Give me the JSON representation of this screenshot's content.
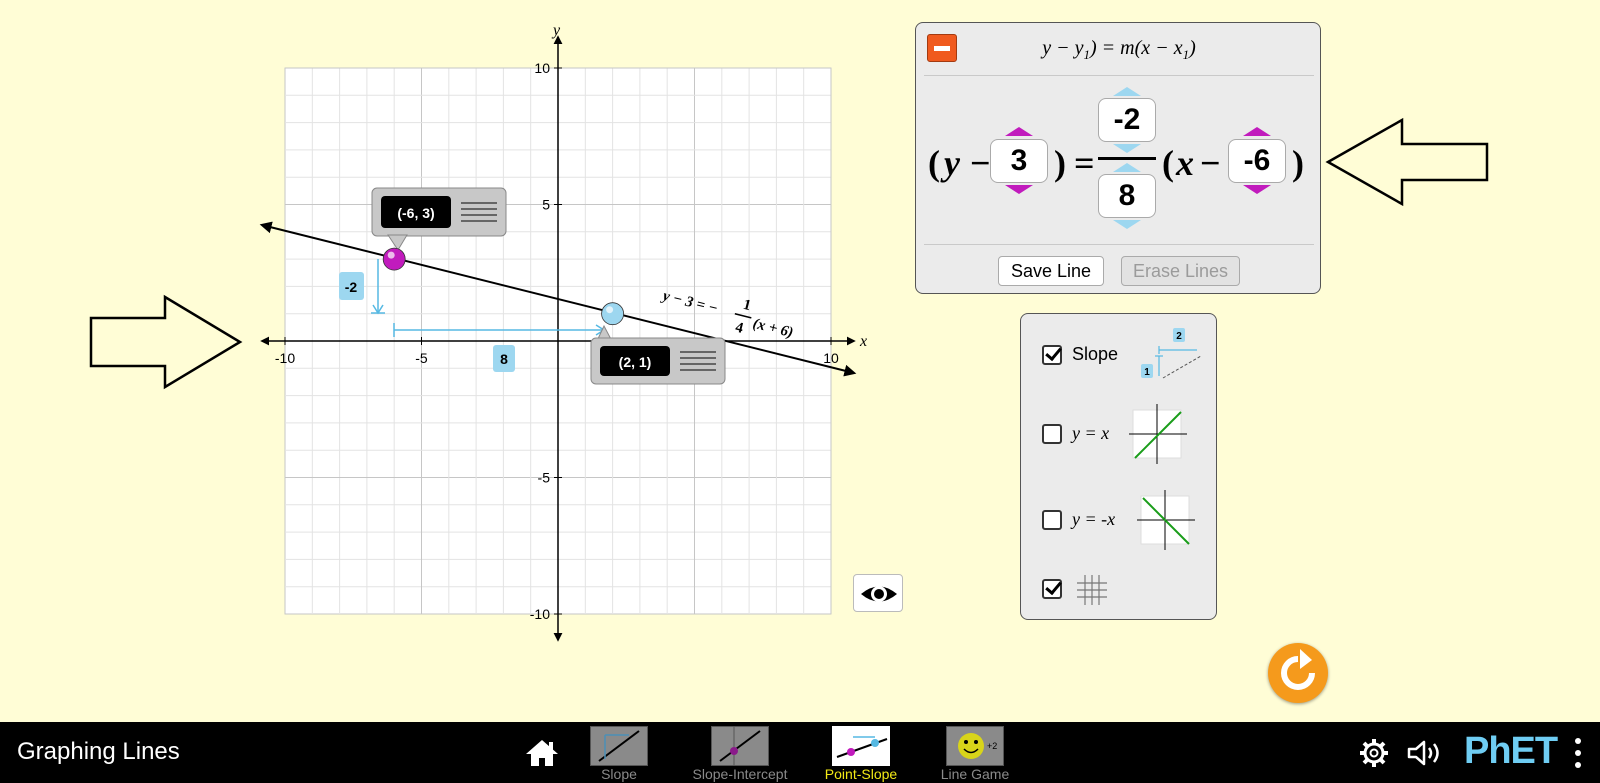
{
  "graph": {
    "axis_x_label": "x",
    "axis_y_label": "y",
    "x_ticks": [
      {
        "value": -10,
        "label": "-10"
      },
      {
        "value": -5,
        "label": "-5"
      },
      {
        "value": 10,
        "label": "10"
      }
    ],
    "y_ticks": [
      {
        "value": 10,
        "label": "10"
      },
      {
        "value": 5,
        "label": "5"
      },
      {
        "value": -5,
        "label": "-5"
      },
      {
        "value": -10,
        "label": "-10"
      }
    ],
    "point1": {
      "label": "(-6, 3)",
      "x": -6,
      "y": 3,
      "color": "#c11bbd"
    },
    "point2": {
      "label": "(2, 1)",
      "x": 2,
      "y": 1,
      "color": "#9dd7f0"
    },
    "rise_label": "-2",
    "run_label": "8",
    "line_equation": {
      "lhs": "y − 3 = −",
      "num": "1",
      "den": "4",
      "rhs": "(x + 6)"
    }
  },
  "equation_panel": {
    "title_y": "y",
    "title_y_sub": "1",
    "title_m": "m",
    "title_x": "x",
    "title_x_sub": "1",
    "y_var": "y",
    "x_var": "x",
    "y1": "3",
    "rise": "-2",
    "run": "8",
    "x1": "-6",
    "save_label": "Save Line",
    "erase_label": "Erase Lines"
  },
  "options": {
    "slope_label": "Slope",
    "slope_checked": true,
    "slope_icon_run": "2",
    "slope_icon_rise": "1",
    "yx_label": "y = x",
    "yx_checked": false,
    "ynx_label": "y = -x",
    "ynx_checked": false,
    "grid_checked": true
  },
  "navbar": {
    "title": "Graphing Lines",
    "tabs": [
      {
        "label": "Slope",
        "active": false
      },
      {
        "label": "Slope-Intercept",
        "active": false
      },
      {
        "label": "Point-Slope",
        "active": true
      },
      {
        "label": "Line Game",
        "active": false
      }
    ],
    "game_badge": "+2",
    "brand": "PhET"
  },
  "colors": {
    "background": "#fffdd6",
    "point1": "#c11bbd",
    "point2": "#9dd7f0",
    "slope_indicator": "#56b9e3",
    "collapse_button": "#f05a1e",
    "reset_button": "#f59a1c",
    "active_tab": "#f2e916",
    "reference_line": "#1a9d1a"
  }
}
